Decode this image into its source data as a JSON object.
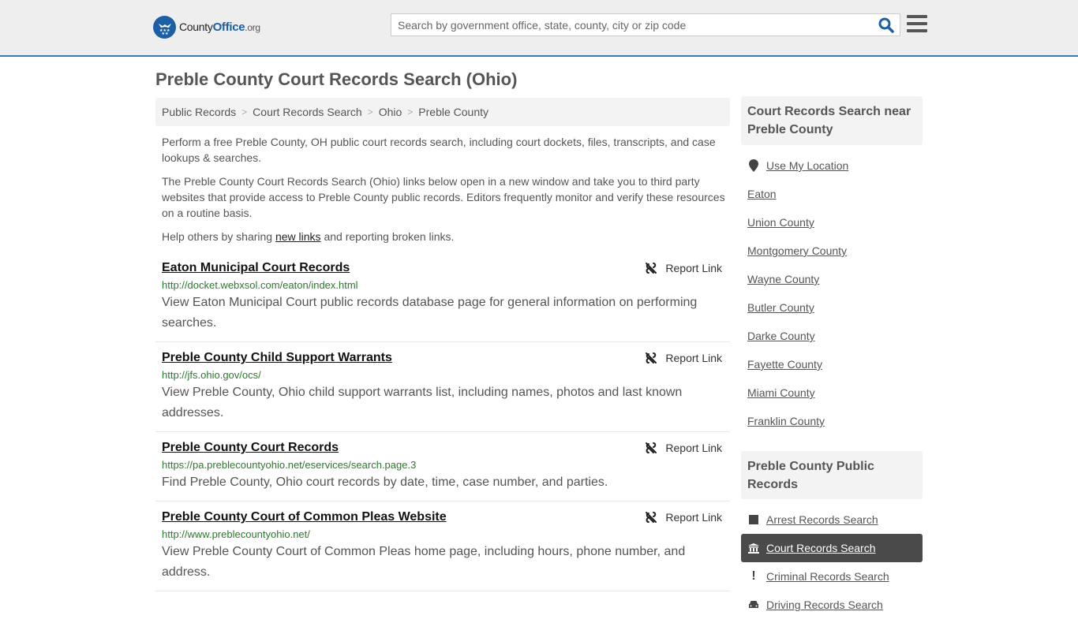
{
  "header": {
    "logo": {
      "name": "County",
      "accent": "Office",
      "tld": ".org"
    },
    "search": {
      "placeholder": "Search by government office, state, county, city or zip code",
      "value": ""
    },
    "brand_color": "#1d5fa5",
    "border_color": "#3b7bb0"
  },
  "page": {
    "title": "Preble County Court Records Search (Ohio)",
    "breadcrumb": [
      "Public Records",
      "Court Records Search",
      "Ohio",
      "Preble County"
    ],
    "intro": {
      "p1": "Perform a free Preble County, OH public court records search, including court dockets, files, transcripts, and case lookups & searches.",
      "p2": "The Preble County Court Records Search (Ohio) links below open in a new window and take you to third party websites that provide access to Preble County public records. Editors frequently monitor and verify these resources on a routine basis.",
      "p3_before": "Help others by sharing ",
      "p3_link": "new links",
      "p3_after": " and reporting broken links."
    }
  },
  "links": [
    {
      "title": "Eaton Municipal Court Records",
      "url": "http://docket.webxsol.com/eaton/index.html",
      "description": "View Eaton Municipal Court public records database page for general information on performing searches.",
      "report_label": "Report Link"
    },
    {
      "title": "Preble County Child Support Warrants",
      "url": "http://jfs.ohio.gov/ocs/",
      "description": "View Preble County, Ohio child support warrants list, including names, photos and last known addresses.",
      "report_label": "Report Link"
    },
    {
      "title": "Preble County Court Records",
      "url": "https://pa.preblecountyohio.net/eservices/search.page.3",
      "description": "Find Preble County, Ohio court records by date, time, case number, and parties.",
      "report_label": "Report Link"
    },
    {
      "title": "Preble County Court of Common Pleas Website",
      "url": "http://www.preblecountyohio.net/",
      "description": "View Preble County Court of Common Pleas home page, including hours, phone number, and address.",
      "report_label": "Report Link"
    }
  ],
  "sidebar": {
    "nearby": {
      "heading": "Court Records Search near Preble County",
      "use_location": "Use My Location",
      "items": [
        "Eaton",
        "Union County",
        "Montgomery County",
        "Wayne County",
        "Butler County",
        "Darke County",
        "Fayette County",
        "Miami County",
        "Franklin County"
      ]
    },
    "public_records": {
      "heading": "Preble County Public Records",
      "items": [
        {
          "label": "Arrest Records Search",
          "icon": "square-icon",
          "active": false
        },
        {
          "label": "Court Records Search",
          "icon": "courthouse-icon",
          "active": true
        },
        {
          "label": "Criminal Records Search",
          "icon": "exclamation-icon",
          "active": false
        },
        {
          "label": "Driving Records Search",
          "icon": "car-icon",
          "active": false
        }
      ]
    }
  }
}
